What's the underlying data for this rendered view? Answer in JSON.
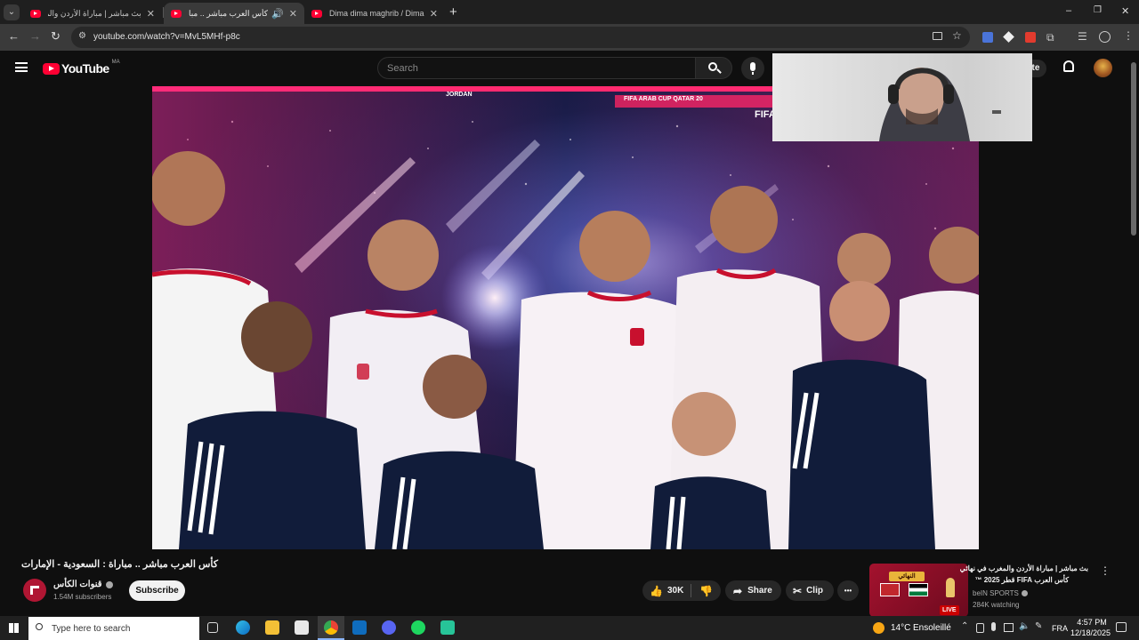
{
  "browser": {
    "tabs": [
      {
        "title": "بث مباشر | مباراة الأردن والمغرب",
        "active": false
      },
      {
        "title": "كأس العرب مباشر .. مباراة : الا",
        "active": true
      },
      {
        "title": "Dima dima maghrib / Dima ma",
        "active": false
      }
    ],
    "new_tab": "+",
    "url": "youtube.com/watch?v=MvL5MHf-p8c",
    "window_controls": {
      "minimize": "–",
      "restore": "❐",
      "close": "✕"
    }
  },
  "youtube": {
    "logo_text": "YouTube",
    "region": "MA",
    "search_placeholder": "Search",
    "create_partial": "ate",
    "video_title": "كأس العرب مباشر .. مباراة : السعودية - الإمارات",
    "channel_name": "قنوات الكأس",
    "subscribers": "1.54M subscribers",
    "subscribe_label": "Subscribe",
    "likes": "30K",
    "share_label": "Share",
    "clip_label": "Clip",
    "more_label": "•••",
    "recommended": {
      "title_line1": "بث مباشر | مباراة الأردن والمغرب في نهائي",
      "title_line2": "كأس العرب FIFA قطر 2025 ™",
      "channel": "beIN SPORTS",
      "watching": "284K watching",
      "live_badge": "LIVE",
      "thumb_label": "النهائي"
    }
  },
  "overlay": {
    "stadium_banner": "FIFA ARAB CUP QATAR 20",
    "team_label": "JORDAN",
    "broadcast_logo": "FIFA"
  },
  "taskbar": {
    "search_placeholder": "Type here to search",
    "temperature": "14°C",
    "weather": "Ensoleillé",
    "language": "FRA",
    "time": "4:57 PM",
    "date": "12/18/2025"
  },
  "colors": {
    "youtube_red": "#ff0033",
    "jersey_red": "#c8102e",
    "jersey_white": "#f4f4f4",
    "kit_navy": "#111c3a"
  }
}
